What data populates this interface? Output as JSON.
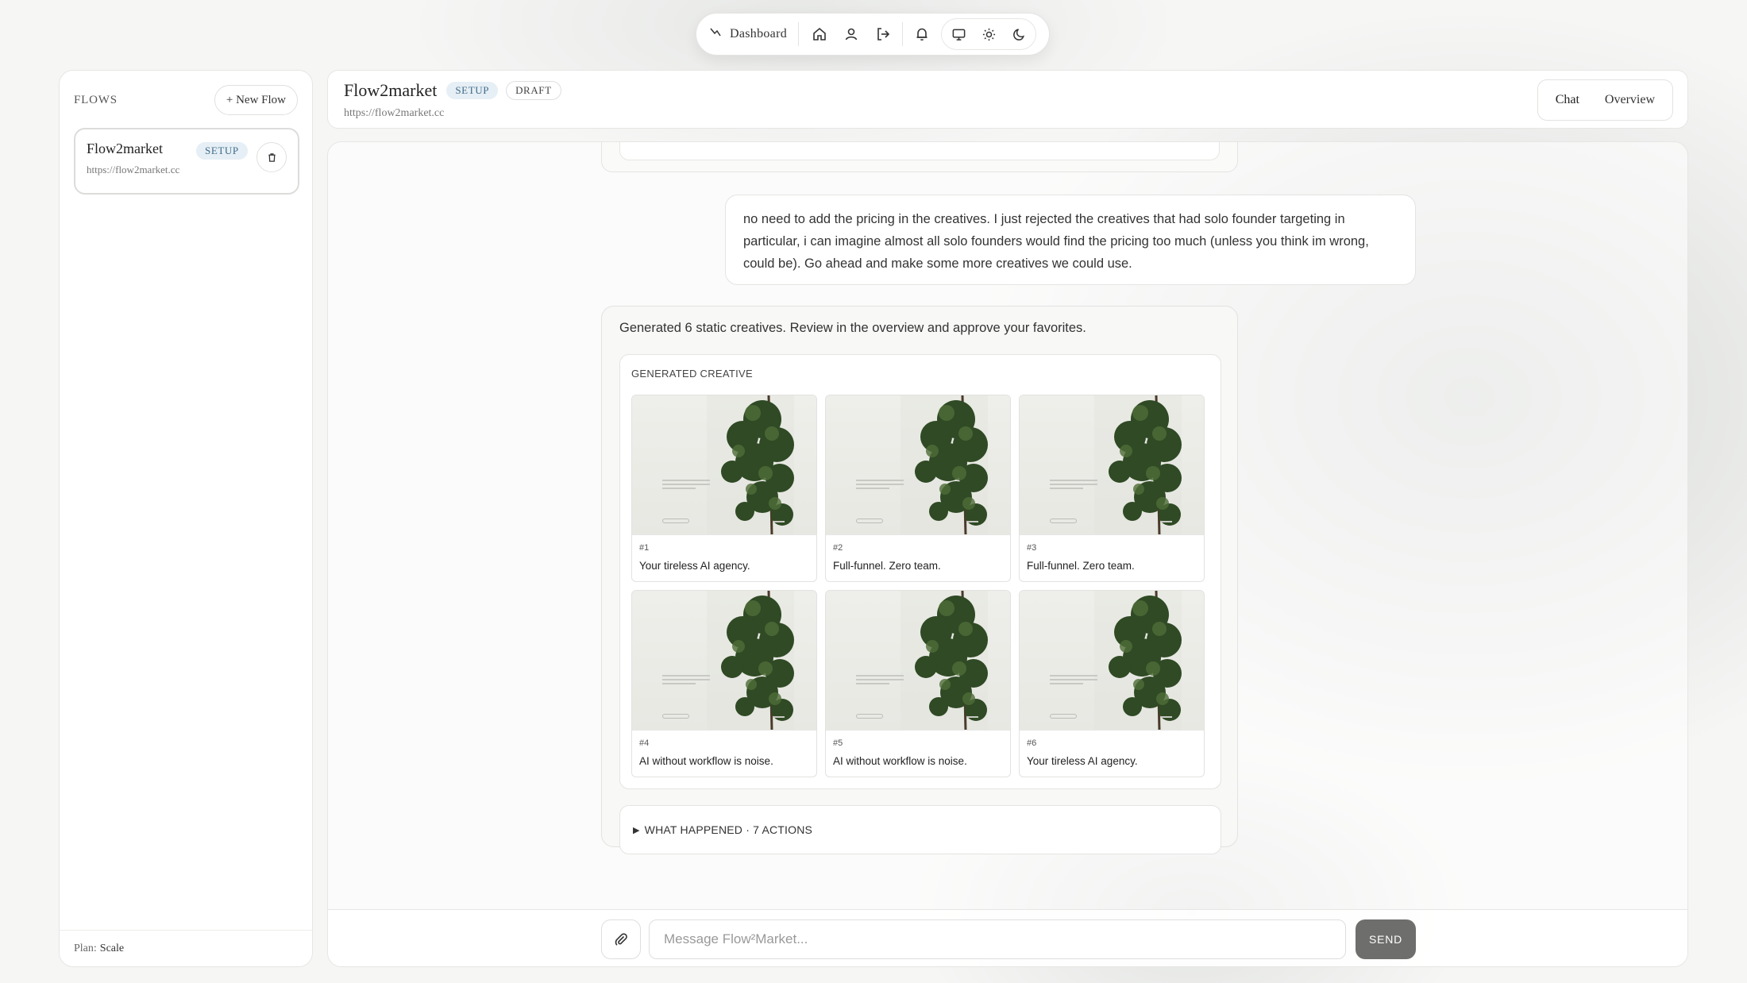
{
  "topnav": {
    "dashboard_label": "Dashboard",
    "icons": [
      "dashboard-icon",
      "home-icon",
      "user-icon",
      "logout-icon",
      "bell-icon",
      "monitor-icon",
      "sun-icon",
      "moon-icon"
    ]
  },
  "sidebar": {
    "title": "FLOWS",
    "new_flow_label": "+ New Flow",
    "flows": [
      {
        "name": "Flow2market",
        "badge": "SETUP",
        "url": "https://flow2market.cc"
      }
    ],
    "plan_label": "Plan:",
    "plan_value": "Scale"
  },
  "header": {
    "title": "Flow2market",
    "badge_setup": "SETUP",
    "badge_draft": "DRAFT",
    "url": "https://flow2market.cc",
    "tabs": [
      {
        "label": "Chat"
      },
      {
        "label": "Overview"
      }
    ]
  },
  "chat": {
    "user_message": "no need to add the pricing in the creatives. I just rejected the creatives that had solo founder targeting in particular, i can imagine almost all solo founders would find the pricing too much (unless you think im wrong, could be). Go ahead and make some more creatives we could use.",
    "assistant_message": "Generated 6 static creatives. Review in the overview and approve your favorites.",
    "generated_title": "GENERATED CREATIVE",
    "creatives": [
      {
        "num": "#1",
        "caption": "Your tireless AI agency."
      },
      {
        "num": "#2",
        "caption": "Full-funnel. Zero team."
      },
      {
        "num": "#3",
        "caption": "Full-funnel. Zero team."
      },
      {
        "num": "#4",
        "caption": "AI without workflow is noise."
      },
      {
        "num": "#5",
        "caption": "AI without workflow is noise."
      },
      {
        "num": "#6",
        "caption": "Your tireless AI agency."
      }
    ],
    "what_happened": "WHAT HAPPENED · 7 ACTIONS"
  },
  "composer": {
    "placeholder": "Message Flow²Market...",
    "send_label": "SEND"
  }
}
